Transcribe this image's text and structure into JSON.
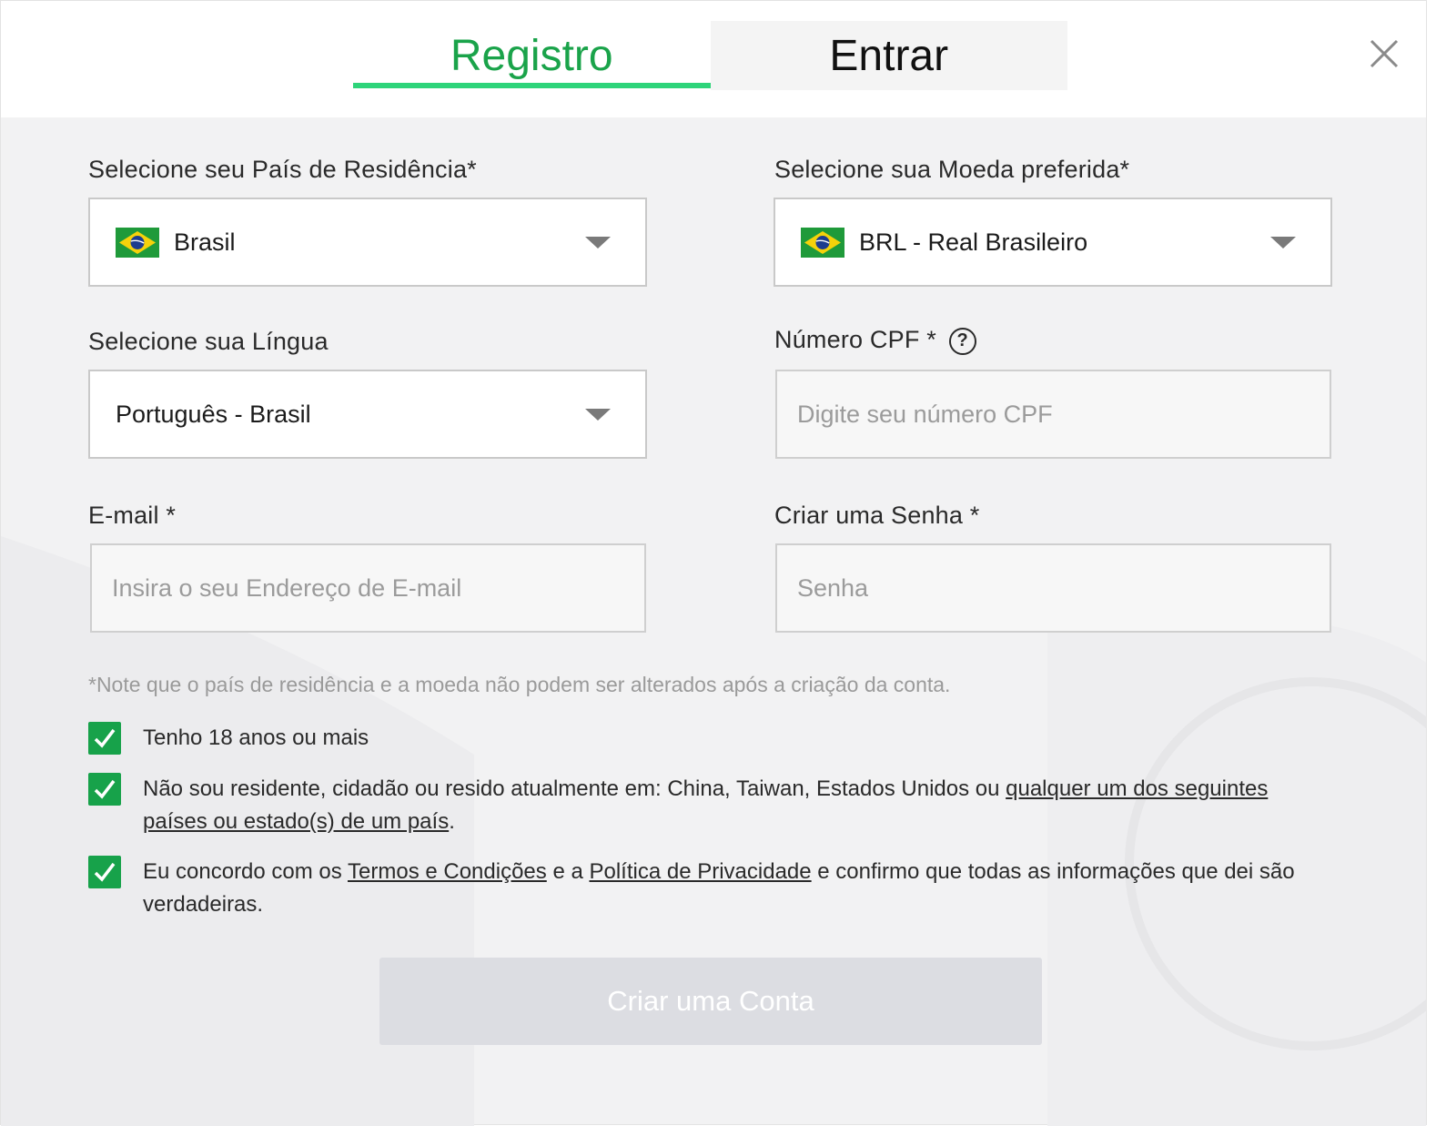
{
  "tabs": {
    "register": "Registro",
    "login": "Entrar"
  },
  "icons": {
    "close": "close-icon",
    "flag": "brazil-flag-icon",
    "caret": "chevron-down-icon",
    "help": "help-circle-icon",
    "check": "checkmark-icon"
  },
  "colors": {
    "accent": "#1aa34a",
    "tab_underline": "#2ed47a",
    "checkbox": "#17a24a",
    "button_disabled": "#dcdde2"
  },
  "form": {
    "country": {
      "label": "Selecione seu País de Residência*",
      "value": "Brasil"
    },
    "currency": {
      "label": "Selecione sua Moeda preferida*",
      "value": "BRL - Real Brasileiro"
    },
    "language": {
      "label": "Selecione sua Língua",
      "value": "Português - Brasil"
    },
    "cpf": {
      "label": "Número CPF *",
      "help": "?",
      "placeholder": "Digite seu número CPF"
    },
    "email": {
      "label": "E-mail *",
      "placeholder": "Insira o seu Endereço de E-mail"
    },
    "password": {
      "label": "Criar uma Senha *",
      "placeholder": "Senha"
    },
    "note": "*Note que o país de residência e a moeda não podem ser alterados após a criação da conta.",
    "checks": {
      "age": {
        "text": "Tenho 18 anos ou mais",
        "checked": true
      },
      "residence": {
        "text_before": "Não sou residente, cidadão ou resido atualmente em: China, Taiwan, Estados Unidos ou ",
        "link": "qualquer um dos seguintes países ou estado(s) de um país",
        "text_after": ".",
        "checked": true
      },
      "terms": {
        "text_1": "Eu concordo com os ",
        "link_terms": "Termos e Condições",
        "text_2": " e a ",
        "link_privacy": "Política de Privacidade",
        "text_3": " e confirmo que todas as informações que dei são verdadeiras.",
        "checked": true
      }
    },
    "submit_label": "Criar uma Conta"
  }
}
